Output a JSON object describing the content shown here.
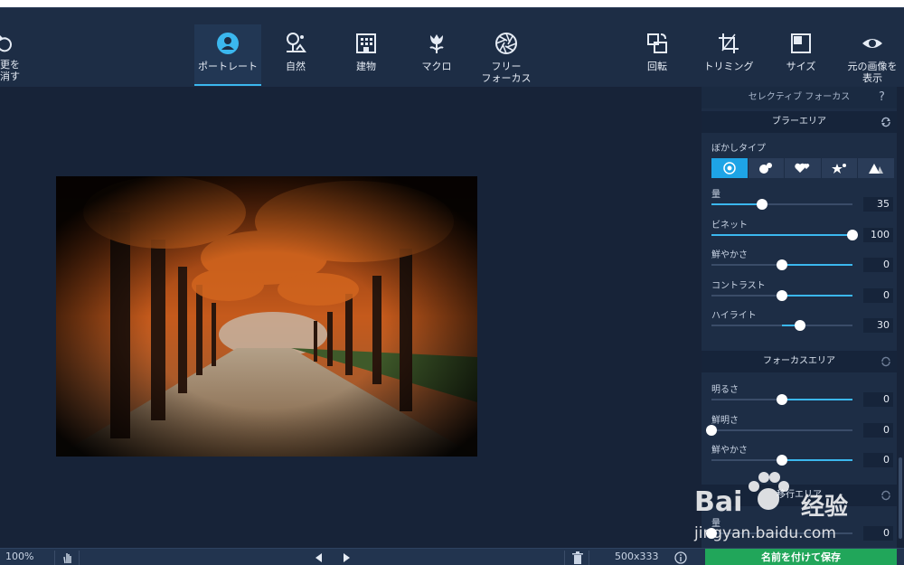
{
  "toolbar": {
    "undo_label": "更を\n消す",
    "tools": [
      {
        "id": "portrait",
        "label": "ポートレート",
        "icon": "portrait-icon",
        "active": true
      },
      {
        "id": "nature",
        "label": "自然",
        "icon": "nature-icon"
      },
      {
        "id": "architecture",
        "label": "建物",
        "icon": "building-icon"
      },
      {
        "id": "macro",
        "label": "マクロ",
        "icon": "macro-flower-icon"
      },
      {
        "id": "free-focus",
        "label": "フリー\nフォーカス",
        "icon": "aperture-icon"
      },
      {
        "id": "rotate",
        "label": "回転",
        "icon": "rotate-icon"
      },
      {
        "id": "crop",
        "label": "トリミング",
        "icon": "crop-icon"
      },
      {
        "id": "size",
        "label": "サイズ",
        "icon": "resize-icon"
      },
      {
        "id": "original",
        "label": "元の画像を\n表示",
        "icon": "eye-icon"
      }
    ]
  },
  "panel": {
    "title": "セレクティブ フォーカス",
    "help": "?",
    "blur_section": "ブラーエリア",
    "blur_type_label": "ぼかしタイプ",
    "blur_types": [
      "circle-bokeh-icon",
      "dot-bokeh-icon",
      "heart-bokeh-icon",
      "star-bokeh-icon",
      "triangle-bokeh-icon"
    ],
    "blur_sliders": [
      {
        "label": "量",
        "value": "35",
        "level": 0.36
      },
      {
        "label": "ビネット",
        "value": "100",
        "level": 1.0
      },
      {
        "label": "鮮やかさ",
        "value": "0",
        "level": 0.5,
        "centered": true
      },
      {
        "label": "コントラスト",
        "value": "0",
        "level": 0.5,
        "centered": true
      },
      {
        "label": "ハイライト",
        "value": "30",
        "level": 0.63,
        "centered": true
      }
    ],
    "focus_section": "フォーカスエリア",
    "focus_sliders": [
      {
        "label": "明るさ",
        "value": "0",
        "level": 0.5,
        "centered": true
      },
      {
        "label": "鮮明さ",
        "value": "0",
        "level": 0.0
      },
      {
        "label": "鮮やかさ",
        "value": "0",
        "level": 0.5,
        "centered": true
      }
    ],
    "third_section": "移行エリア",
    "third_sliders": [
      {
        "label": "量",
        "value": "0",
        "level": 0.0
      }
    ]
  },
  "bottombar": {
    "zoom": "100%",
    "dimensions": "500x333",
    "save_label": "名前を付けて保存"
  },
  "watermark": {
    "brand": "Bai",
    "brand2": "经验",
    "url": "jingyan.baidu.com"
  },
  "colors": {
    "accent": "#3bb7ee",
    "save": "#21a65a",
    "panel": "#1d2d45",
    "background": "#172338"
  }
}
